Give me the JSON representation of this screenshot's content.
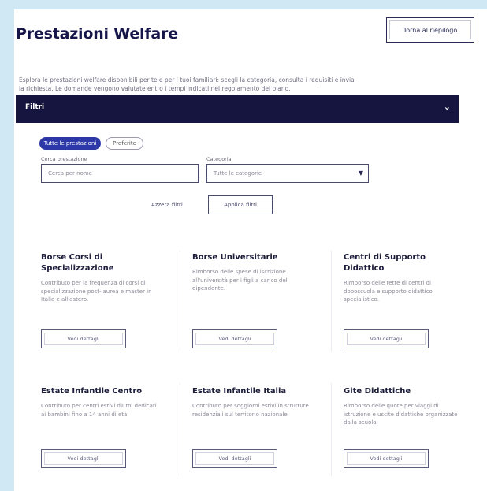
{
  "header": {
    "title": "Prestazioni Welfare",
    "action_label": "Torna al riepilogo"
  },
  "intro": {
    "text": "Esplora le prestazioni welfare disponibili per te e per i tuoi familiari: scegli la categoria, consulta i requisiti e invia la richiesta. Le domande vengono valutate entro i tempi indicati nel regolamento del piano."
  },
  "filter_bar": {
    "label": "Filtri",
    "toggle_icon": "chevron-down-icon"
  },
  "filters": {
    "pill_active": "Tutte le prestazioni",
    "pill_inactive": "Preferite",
    "search_label": "Cerca prestazione",
    "search_placeholder": "Cerca per nome",
    "select_label": "Categoria",
    "select_value": "Tutte le categorie",
    "reset_label": "Azzera filtri",
    "apply_label": "Applica filtri"
  },
  "cards": [
    {
      "title": "Borse Corsi di Specializzazione",
      "desc": "Contributo per la frequenza di corsi di specializzazione post-laurea e master in Italia e all'estero.",
      "button": "Vedi dettagli"
    },
    {
      "title": "Borse Universitarie",
      "desc": "Rimborso delle spese di iscrizione all'università per i figli a carico del dipendente.",
      "button": "Vedi dettagli"
    },
    {
      "title": "Centri di Supporto Didattico",
      "desc": "Rimborso delle rette di centri di doposcuola e supporto didattico specialistico.",
      "button": "Vedi dettagli"
    },
    {
      "title": "Estate Infantile Centro",
      "desc": "Contributo per centri estivi diurni dedicati ai bambini fino a 14 anni di età.",
      "button": "Vedi dettagli"
    },
    {
      "title": "Estate Infantile Italia",
      "desc": "Contributo per soggiorni estivi in strutture residenziali sul territorio nazionale.",
      "button": "Vedi dettagli"
    },
    {
      "title": "Gite Didattiche",
      "desc": "Rimborso delle quote per viaggi di istruzione e uscite didattiche organizzate dalla scuola.",
      "button": "Vedi dettagli"
    }
  ]
}
